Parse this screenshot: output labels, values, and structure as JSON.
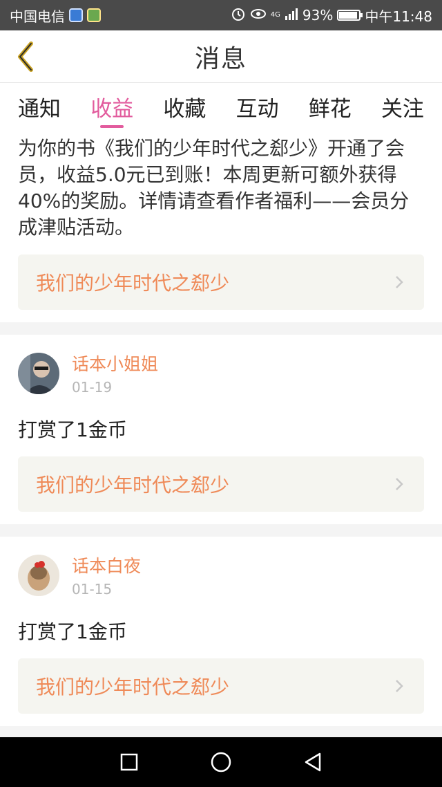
{
  "status_bar": {
    "carrier": "中国电信",
    "network": "4G",
    "battery": "93%",
    "battery_level": 0.93,
    "time": "中午11:48",
    "icons": [
      "shield-app-icon",
      "green-app-icon",
      "alarm-icon",
      "eye-icon",
      "signal-icon",
      "battery-icon"
    ]
  },
  "header": {
    "title": "消息",
    "back_icon": "chevron-left-icon"
  },
  "tabs": [
    {
      "label": "通知",
      "active": false
    },
    {
      "label": "收益",
      "active": true
    },
    {
      "label": "收藏",
      "active": false
    },
    {
      "label": "互动",
      "active": false
    },
    {
      "label": "鲜花",
      "active": false
    },
    {
      "label": "关注",
      "active": false
    }
  ],
  "notice": {
    "text": "为你的书《我们的少年时代之郄少》开通了会员，收益5.0元已到账！本周更新可额外获得40%的奖励。详情请查看作者福利——会员分成津贴活动。",
    "book_title": "我们的少年时代之郄少"
  },
  "messages": [
    {
      "user": "话本小姐姐",
      "date": "01-19",
      "action": "打赏了1金币",
      "book_title": "我们的少年时代之郄少"
    },
    {
      "user": "话本白夜",
      "date": "01-15",
      "action": "打赏了1金币",
      "book_title": "我们的少年时代之郄少"
    }
  ],
  "colors": {
    "accent": "#e25b9d",
    "book_link": "#ef8a58",
    "status_bar": "#4a4a4a",
    "nav_bar": "#000000"
  },
  "nav_bar": {
    "icons": [
      "square-recent-icon",
      "circle-home-icon",
      "triangle-back-icon"
    ]
  }
}
